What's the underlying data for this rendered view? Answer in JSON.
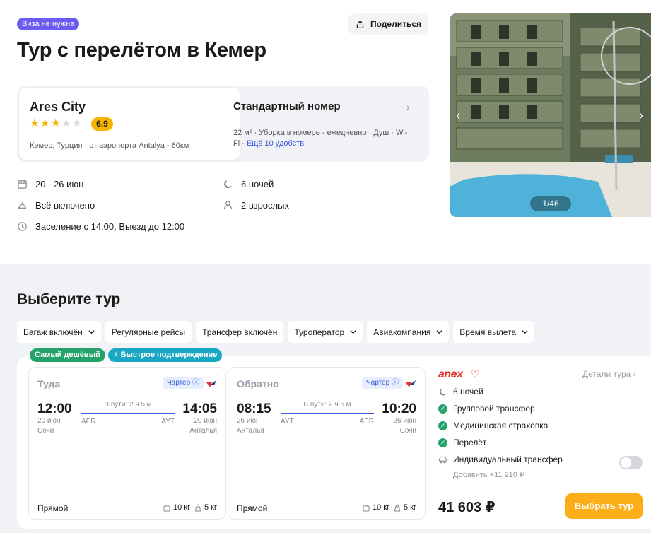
{
  "header": {
    "visa_badge": "Виза не нужна",
    "share_label": "Поделиться",
    "title": "Тур с перелётом в Кемер"
  },
  "hotel": {
    "name": "Ares City",
    "stars": 3,
    "rating": "6.9",
    "location": "Кемер, Турция · от аэропорта Antalya - 60км"
  },
  "room": {
    "title": "Стандартный номер",
    "description": "22 м² · Уборка в номере - ежедневно · Душ · Wi-Fi ·",
    "more_link": "Ещё 10 удобств"
  },
  "facts": {
    "dates": "20 - 26 июн",
    "nights": "6 ночей",
    "meal": "Всё включено",
    "guests": "2 взрослых",
    "checkin": "Заселение с 14:00, Выезд до 12:00"
  },
  "gallery": {
    "counter": "1/46"
  },
  "tours": {
    "section_title": "Выберите тур",
    "filters": [
      {
        "label": "Багаж включён",
        "has_dropdown": true
      },
      {
        "label": "Регулярные рейсы",
        "has_dropdown": false
      },
      {
        "label": "Трансфер включён",
        "has_dropdown": false
      },
      {
        "label": "Туроператор",
        "has_dropdown": true
      },
      {
        "label": "Авиакомпания",
        "has_dropdown": true
      },
      {
        "label": "Время вылета",
        "has_dropdown": true
      }
    ],
    "tags": [
      "Самый дешёвый",
      "Быстрое подтверждение"
    ]
  },
  "flights": {
    "outbound": {
      "label": "Туда",
      "charter": "Чартер",
      "depart_time": "12:00",
      "depart_date": "20 июн",
      "depart_city": "Сочи",
      "depart_iata": "AER",
      "arrive_time": "14:05",
      "arrive_date": "20 июн",
      "arrive_city": "Анталья",
      "arrive_iata": "AYT",
      "duration": "В пути: 2 ч 5 м",
      "type": "Прямой",
      "baggage": "10 кг",
      "hand_luggage": "5 кг"
    },
    "return": {
      "label": "Обратно",
      "charter": "Чартер",
      "depart_time": "08:15",
      "depart_date": "26 июн",
      "depart_city": "Анталья",
      "depart_iata": "AYT",
      "arrive_time": "10:20",
      "arrive_date": "26 июн",
      "arrive_city": "Сочи",
      "arrive_iata": "AER",
      "duration": "В пути: 2 ч 5 м",
      "type": "Прямой",
      "baggage": "10 кг",
      "hand_luggage": "5 кг"
    }
  },
  "offer": {
    "operator": "anex",
    "details_link": "Детали тура",
    "nights": "6 ночей",
    "included": [
      "Групповой трансфер",
      "Медицинская страховка",
      "Перелёт"
    ],
    "addon_label": "Индивидуальный трансфер",
    "addon_price": "Добавить +11 210 ₽",
    "price": "41 603 ₽",
    "cta": "Выбрать тур"
  },
  "colors": {
    "accent": "#3b5bdb",
    "visa_badge": "#6a5cf0",
    "rating": "#f4b400",
    "cheapest_tag": "#24a36b",
    "fast_tag": "#1aa7c4",
    "cta": "#fbae17",
    "operator_brand": "#e5322d"
  }
}
